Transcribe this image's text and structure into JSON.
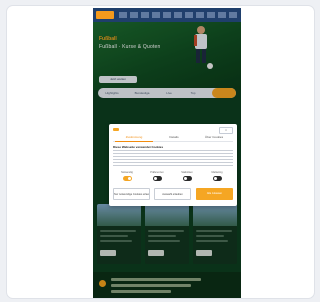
{
  "site": {
    "hero_tag": "Fußball",
    "hero_title": "Fußball · Kurse & Quoten",
    "hero_button": "Jetzt wetten",
    "tabs": [
      {
        "label": "Highlights",
        "active": false
      },
      {
        "label": "Bundesliga",
        "active": false
      },
      {
        "label": "Live",
        "active": false
      },
      {
        "label": "Top",
        "active": false
      },
      {
        "label": "",
        "active": true
      }
    ]
  },
  "cookie_modal": {
    "close_label": "×",
    "tabs": [
      {
        "label": "Zustimmung",
        "active": true
      },
      {
        "label": "Details",
        "active": false
      },
      {
        "label": "Über Cookies",
        "active": false
      }
    ],
    "heading": "Diese Webseite verwendet Cookies",
    "toggles": [
      {
        "label": "Notwendig",
        "on": true
      },
      {
        "label": "Präferenzen",
        "on": false
      },
      {
        "label": "Statistiken",
        "on": false
      },
      {
        "label": "Marketing",
        "on": false
      }
    ],
    "buttons": {
      "deny": "Nur notwendige Cookies erlauben",
      "selection": "Auswahl erlauben",
      "accept_all": "Alle zulassen"
    }
  },
  "colors": {
    "accent": "#f5a623",
    "header": "#1f3f6c",
    "background": "#0d3d1f"
  }
}
